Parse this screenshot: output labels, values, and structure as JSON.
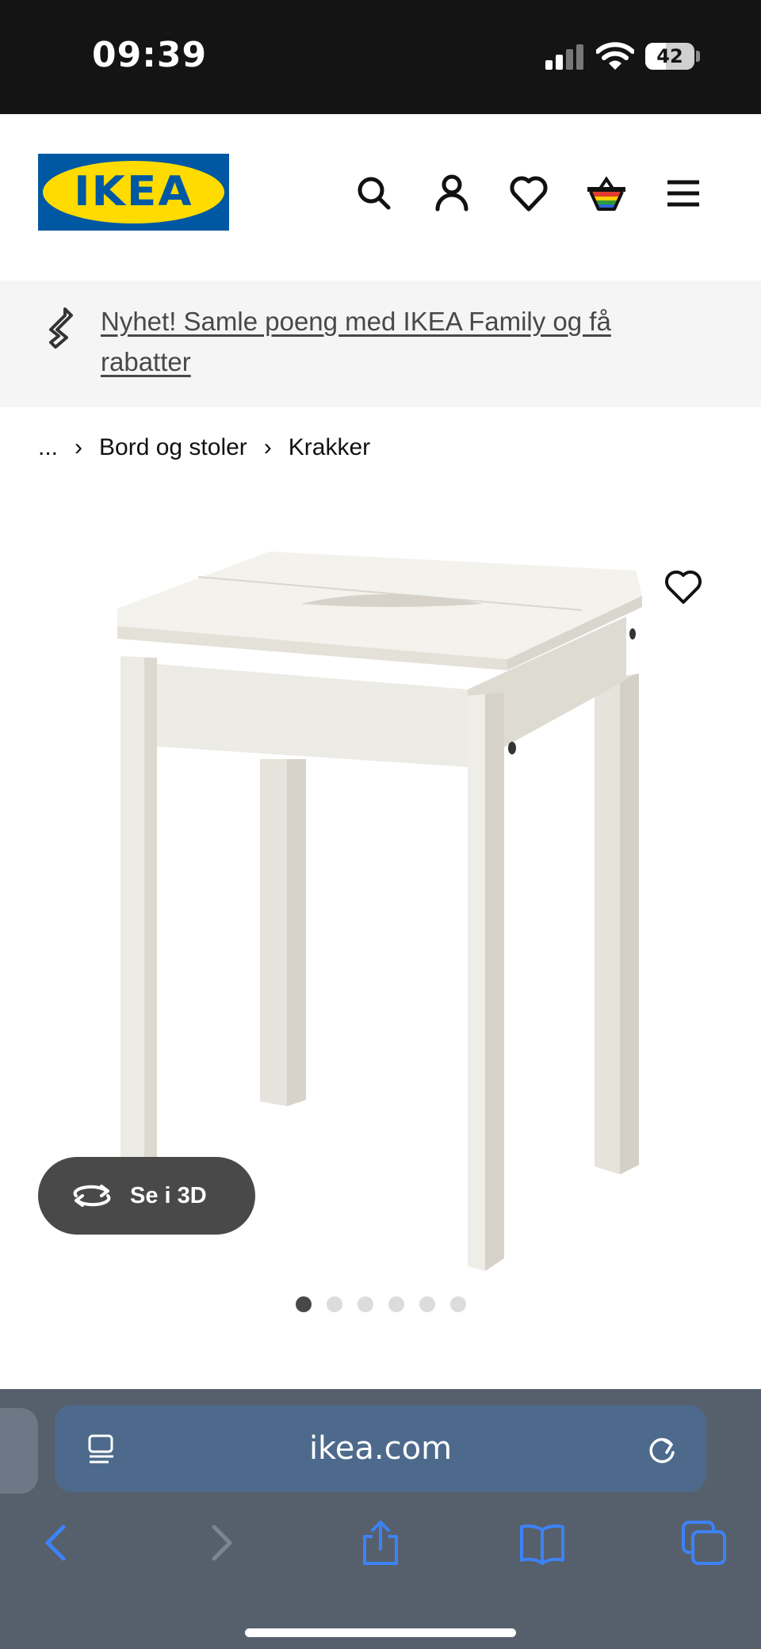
{
  "status_bar": {
    "time": "09:39",
    "battery": "42",
    "battery_level": 0.42,
    "icons": [
      "signal-icon",
      "wifi-icon",
      "battery-icon"
    ]
  },
  "header": {
    "logo_text": "IKEA",
    "icons": [
      "search-icon",
      "account-icon",
      "heart-icon",
      "basket-icon",
      "menu-icon"
    ],
    "colors": {
      "brand_blue": "#0058a3",
      "brand_yellow": "#ffdb00"
    }
  },
  "promo": {
    "text": "Nyhet! Samle poeng med IKEA Family og få rabatter",
    "icon": "ikea-family-icon",
    "background": "#f5f5f5"
  },
  "breadcrumb": {
    "items": [
      "...",
      "Bord og stoler",
      "Krakker"
    ],
    "separator": "›"
  },
  "product": {
    "image": "white-wooden-stool",
    "view_3d_label": "Se i 3D",
    "gallery": {
      "count": 6,
      "active_index": 1
    }
  },
  "browser": {
    "url": "ikea.com",
    "icons": [
      "reader-icon",
      "reload-icon",
      "back-icon",
      "forward-icon",
      "share-icon",
      "bookmarks-icon",
      "tabs-icon"
    ],
    "accent": "#3d82f5"
  }
}
